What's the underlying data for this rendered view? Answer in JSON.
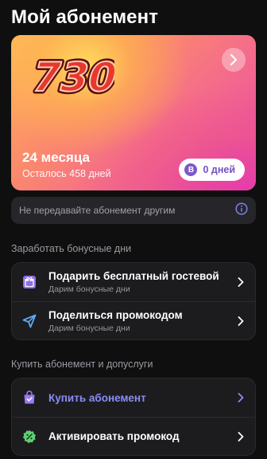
{
  "header": {
    "title": "Мой абонемент"
  },
  "card": {
    "logo_text": "730",
    "months": "24 месяца",
    "remaining": "Осталось 458 дней",
    "bonus_badge": "B",
    "bonus_days": "0 дней"
  },
  "warning": {
    "text": "Не передавайте абонемент другим"
  },
  "bonus_section": {
    "title": "Заработать бонусные дни",
    "items": [
      {
        "label": "Подарить бесплатный гостевой",
        "sub": "Дарим бонусные дни",
        "icon": "gift-icon"
      },
      {
        "label": "Поделиться промокодом",
        "sub": "Дарим бонусные дни",
        "icon": "send-icon"
      }
    ]
  },
  "buy_section": {
    "title": "Купить абонемент и допуслуги",
    "items": [
      {
        "label": "Купить абонемент",
        "icon": "shopping-bag-icon"
      },
      {
        "label": "Активировать промокод",
        "icon": "promo-tag-icon"
      }
    ]
  },
  "colors": {
    "accent": "#8a8cf6",
    "badge": "#7d5ac8",
    "background": "#0f0f10"
  }
}
